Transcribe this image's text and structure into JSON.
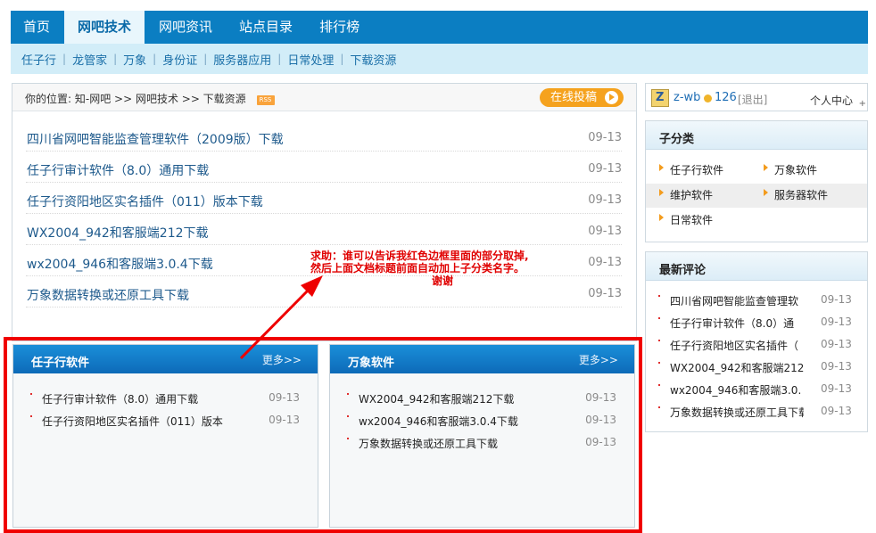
{
  "topnav": {
    "items": [
      "首页",
      "网吧技术",
      "网吧资讯",
      "站点目录",
      "排行榜"
    ],
    "active_index": 1
  },
  "subnav": {
    "items": [
      "任子行",
      "龙管家",
      "万象",
      "身份证",
      "服务器应用",
      "日常处理",
      "下载资源"
    ],
    "separator": "|"
  },
  "breadcrumb": {
    "label": "你的位置:",
    "path": "知-网吧 >> 网吧技术 >> 下载资源",
    "rss": "RSS",
    "submit_button": "在线投稿"
  },
  "documents": [
    {
      "title": "四川省网吧智能监查管理软件（2009版）下载",
      "date": "09-13"
    },
    {
      "title": "任子行审计软件（8.0）通用下载",
      "date": "09-13"
    },
    {
      "title": "任子行资阳地区实名插件（011）版本下载",
      "date": "09-13"
    },
    {
      "title": "WX2004_942和客服端212下载",
      "date": "09-13"
    },
    {
      "title": "wx2004_946和客服端3.0.4下载",
      "date": "09-13"
    },
    {
      "title": "万象数据转换或还原工具下载",
      "date": "09-13"
    }
  ],
  "annotation": {
    "line1": "求助：谁可以告诉我红色边框里面的部分取掉,",
    "line2": "然后上面文档标题前面自动加上子分类名字。",
    "line3": "谢谢",
    "color": "#e00000"
  },
  "cards": [
    {
      "title": "任子行软件",
      "more": "更多>>",
      "items": [
        {
          "title": "任子行审计软件（8.0）通用下载",
          "date": "09-13"
        },
        {
          "title": "任子行资阳地区实名插件（011）版本",
          "date": "09-13"
        }
      ]
    },
    {
      "title": "万象软件",
      "more": "更多>>",
      "items": [
        {
          "title": "WX2004_942和客服端212下载",
          "date": "09-13"
        },
        {
          "title": "wx2004_946和客服端3.0.4下载",
          "date": "09-13"
        },
        {
          "title": "万象数据转换或还原工具下载",
          "date": "09-13"
        }
      ]
    }
  ],
  "user": {
    "name": "z-wb",
    "points": "126",
    "logout": "[退出]",
    "center": "个人中心",
    "plus": "+"
  },
  "subcategories": {
    "title": "子分类",
    "items": [
      "任子行软件",
      "万象软件",
      "维护软件",
      "服务器软件",
      "日常软件"
    ]
  },
  "latest_comments": {
    "title": "最新评论",
    "items": [
      {
        "title": "四川省网吧智能监查管理软",
        "date": "09-13"
      },
      {
        "title": "任子行审计软件（8.0）通",
        "date": "09-13"
      },
      {
        "title": "任子行资阳地区实名插件（",
        "date": "09-13"
      },
      {
        "title": "WX2004_942和客服端212",
        "date": "09-13"
      },
      {
        "title": "wx2004_946和客服端3.0.",
        "date": "09-13"
      },
      {
        "title": "万象数据转换或还原工具下载",
        "date": "09-13"
      }
    ]
  },
  "colors": {
    "nav_blue": "#0b7ec2",
    "subnav_bg": "#d2edf8",
    "frame_red": "#f00000",
    "submit_orange": "#f5a21e"
  }
}
